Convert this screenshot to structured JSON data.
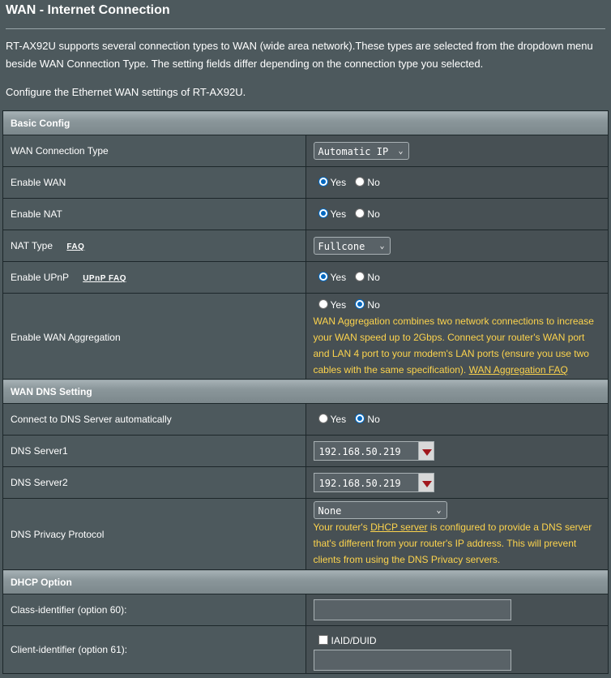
{
  "page": {
    "title": "WAN - Internet Connection",
    "intro": "RT-AX92U supports several connection types to WAN (wide area network).These types are selected from the dropdown menu beside WAN Connection Type. The setting fields differ depending on the connection type you selected.",
    "intro2": "Configure the Ethernet WAN settings of RT-AX92U."
  },
  "basic": {
    "header": "Basic Config",
    "wan_type_label": "WAN Connection Type",
    "wan_type_value": "Automatic IP",
    "enable_wan_label": "Enable WAN",
    "enable_nat_label": "Enable NAT",
    "nat_type_label": "NAT Type",
    "nat_faq": "FAQ",
    "nat_type_value": "Fullcone",
    "upnp_label": "Enable UPnP",
    "upnp_faq": "UPnP FAQ",
    "agg_label": "Enable WAN Aggregation",
    "agg_note": "WAN Aggregation combines two network connections to increase your WAN speed up to 2Gbps. Connect your router's WAN port and LAN 4 port to your modem's LAN ports (ensure you use two cables with the same specification). ",
    "agg_faq": "WAN Aggregation FAQ"
  },
  "radio": {
    "yes": "Yes",
    "no": "No"
  },
  "dns": {
    "header": "WAN DNS Setting",
    "auto_label": "Connect to DNS Server automatically",
    "dns1_label": "DNS Server1",
    "dns1_value": "192.168.50.219",
    "dns2_label": "DNS Server2",
    "dns2_value": "192.168.50.219",
    "privacy_label": "DNS Privacy Protocol",
    "privacy_value": "None",
    "note_pre": "Your router's ",
    "note_link": "DHCP server",
    "note_post": " is configured to provide a DNS server that's different from your router's IP address. This will prevent clients from using the DNS Privacy servers."
  },
  "dhcp": {
    "header": "DHCP Option",
    "class_label": "Class-identifier (option 60):",
    "client_label": "Client-identifier (option 61):",
    "iaid_label": "IAID/DUID"
  },
  "colors": {
    "background": "#4d595d",
    "note_text": "#fcd34d",
    "radio_selected": "#0067c0"
  }
}
